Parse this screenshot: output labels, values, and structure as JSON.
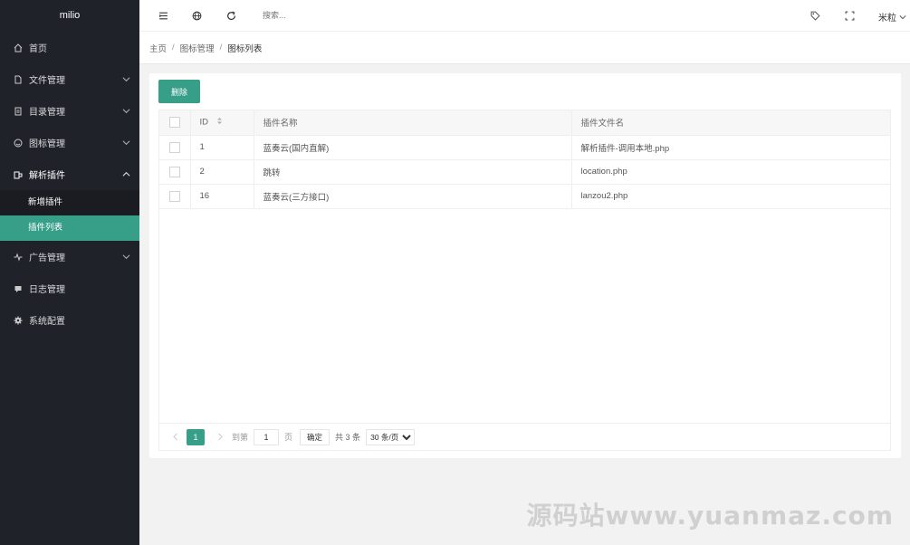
{
  "app": {
    "logo": "milio"
  },
  "sidebar": {
    "items": [
      {
        "label": "首页",
        "icon": "home-icon"
      },
      {
        "label": "文件管理",
        "icon": "file-icon"
      },
      {
        "label": "目录管理",
        "icon": "folder-icon"
      },
      {
        "label": "图标管理",
        "icon": "smile-icon"
      },
      {
        "label": "解析插件",
        "icon": "plugin-icon"
      },
      {
        "label": "广告管理",
        "icon": "pulse-icon"
      },
      {
        "label": "日志管理",
        "icon": "log-icon"
      },
      {
        "label": "系统配置",
        "icon": "gear-icon"
      }
    ],
    "sub": [
      {
        "label": "新增插件"
      },
      {
        "label": "插件列表"
      }
    ]
  },
  "header": {
    "search_placeholder": "搜索...",
    "user": "米粒"
  },
  "breadcrumb": [
    "主页",
    "图标管理",
    "图标列表"
  ],
  "toolbar": {
    "delete_label": "删除"
  },
  "table": {
    "columns": [
      "ID",
      "插件名称",
      "插件文件名"
    ],
    "rows": [
      {
        "id": "1",
        "name": "蓝奏云(国内直解)",
        "file": "解析插件-调用本地.php"
      },
      {
        "id": "2",
        "name": "跳转",
        "file": "location.php"
      },
      {
        "id": "16",
        "name": "蓝奏云(三方接口)",
        "file": "lanzou2.php"
      }
    ]
  },
  "pager": {
    "current": "1",
    "goto_label": "到第",
    "page_input": "1",
    "page_unit": "页",
    "confirm": "确定",
    "total": "共 3 条",
    "per_page": "30 条/页"
  },
  "watermark": "源码站www.yuanmaz.com",
  "colors": {
    "accent": "#379e88",
    "sidebar": "#20222a"
  }
}
